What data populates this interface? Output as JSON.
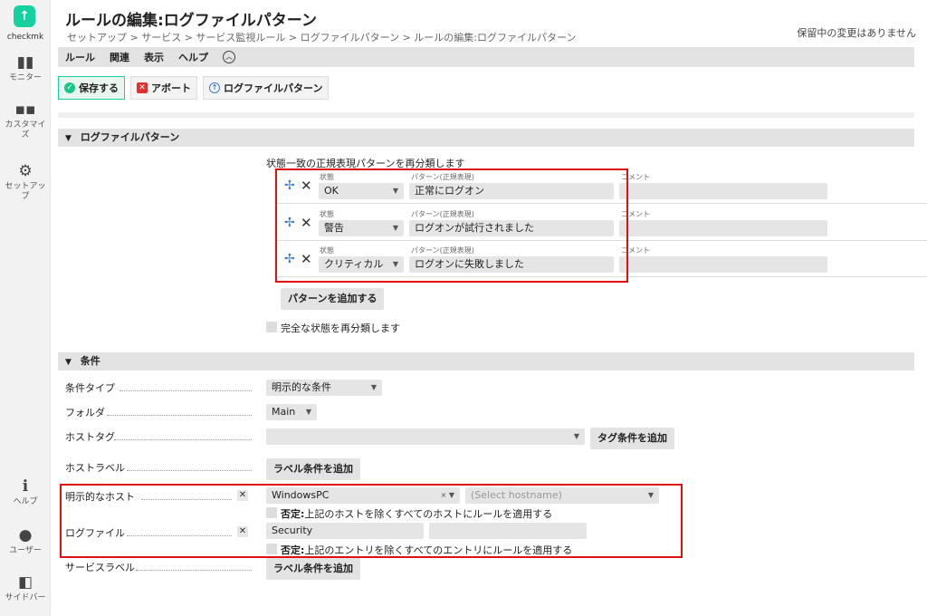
{
  "sidebar": {
    "brand": "checkmk",
    "items": [
      {
        "label": "モニター",
        "icon": "monitor-icon"
      },
      {
        "label": "カスタマイズ",
        "icon": "customize-icon"
      },
      {
        "label": "セットアップ",
        "icon": "setup-icon"
      },
      {
        "label": "ヘルプ",
        "icon": "help-icon"
      },
      {
        "label": "ユーザー",
        "icon": "user-icon"
      },
      {
        "label": "サイドバー",
        "icon": "sidebar-icon"
      }
    ]
  },
  "header": {
    "title": "ルールの編集:ログファイルパターン",
    "breadcrumb": "セットアップ > サービス > サービス監視ルール > ログファイルパターン > ルールの編集:ログファイルパターン",
    "pending": "保留中の変更はありません"
  },
  "menubar": [
    "ルール",
    "関連",
    "表示",
    "ヘルプ"
  ],
  "toolbar": {
    "save": "保存する",
    "abort": "アボート",
    "logfile_pattern": "ログファイルパターン"
  },
  "patterns_section": {
    "title": "ログファイルパターン",
    "description": "状態一致の正規表現パターンを再分類します",
    "state_label": "状態",
    "pattern_label": "パターン(正規表現)",
    "comment_label": "コメント",
    "rows": [
      {
        "state": "OK",
        "pattern": "正常にログオン",
        "comment": ""
      },
      {
        "state": "警告",
        "pattern": "ログオンが試行されました",
        "comment": ""
      },
      {
        "state": "クリティカル",
        "pattern": "ログオンに失敗しました",
        "comment": ""
      }
    ],
    "add_pattern": "パターンを追加する",
    "reclassify_full": "完全な状態を再分類します"
  },
  "conditions_section": {
    "title": "条件",
    "condition_type_label": "条件タイプ",
    "condition_type_value": "明示的な条件",
    "folder_label": "フォルダ",
    "folder_value": "Main",
    "host_tags_label": "ホストタグ",
    "add_tag_condition": "タグ条件を追加",
    "host_labels_label": "ホストラベル",
    "add_label_condition": "ラベル条件を追加",
    "explicit_hosts_label": "明示的なホスト",
    "explicit_host_value": "WindowsPC",
    "select_hostname_placeholder": "(Select hostname)",
    "negate_hosts_prefix": "否定:",
    "negate_hosts_text": "上記のホストを除くすべてのホストにルールを適用する",
    "logfiles_label": "ログファイル",
    "logfile_value": "Security",
    "negate_entries_prefix": "否定:",
    "negate_entries_text": "上記のエントリを除くすべてのエントリにルールを適用する",
    "service_labels_label": "サービスラベル",
    "add_service_label_condition": "ラベル条件を追加"
  },
  "colors": {
    "accent": "#15d1a0",
    "highlight": "#e01010",
    "link": "#3480c6"
  }
}
